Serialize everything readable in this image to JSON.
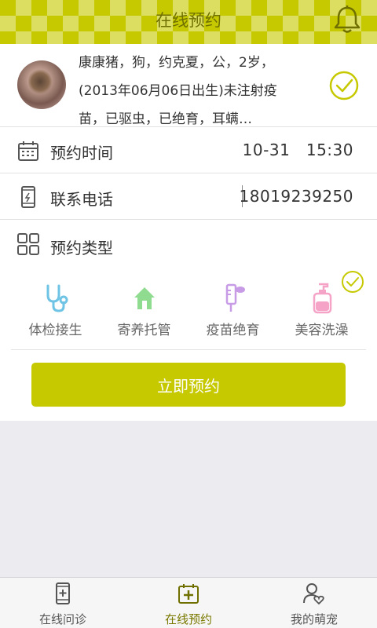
{
  "header": {
    "title": "在线预约",
    "bell_icon": "bell-icon"
  },
  "pet": {
    "lines": [
      "康康猪，狗，约克夏，公，2岁，",
      "(2013年06月06日出生)未注射疫",
      "苗，已驱虫，已绝育，耳螨…"
    ],
    "selected": true
  },
  "appointment_time": {
    "label": "预约时间",
    "value": "10-31   15:30",
    "icon": "calendar-icon"
  },
  "phone": {
    "label": "联系电话",
    "value": "18019239250",
    "icon": "phone-icon"
  },
  "appointment_type": {
    "label": "预约类型",
    "icon": "grid-icon",
    "options": [
      {
        "label": "体检接生",
        "icon": "stethoscope-icon",
        "color": "#6fc4e6",
        "selected": false
      },
      {
        "label": "寄养托管",
        "icon": "house-icon",
        "color": "#8fdc90",
        "selected": false
      },
      {
        "label": "疫苗绝育",
        "icon": "syringe-icon",
        "color": "#c79be6",
        "selected": false
      },
      {
        "label": "美容洗澡",
        "icon": "shampoo-bottle-icon",
        "color": "#f5a3c6",
        "selected": true
      }
    ]
  },
  "submit_label": "立即预约",
  "bottom_nav": [
    {
      "label": "在线问诊",
      "icon": "medical-phone-icon",
      "active": false
    },
    {
      "label": "在线预约",
      "icon": "calendar-plus-icon",
      "active": true
    },
    {
      "label": "我的萌宠",
      "icon": "user-heart-icon",
      "active": false
    }
  ],
  "colors": {
    "accent": "#c6c900",
    "accent_dark": "#6f7000"
  }
}
